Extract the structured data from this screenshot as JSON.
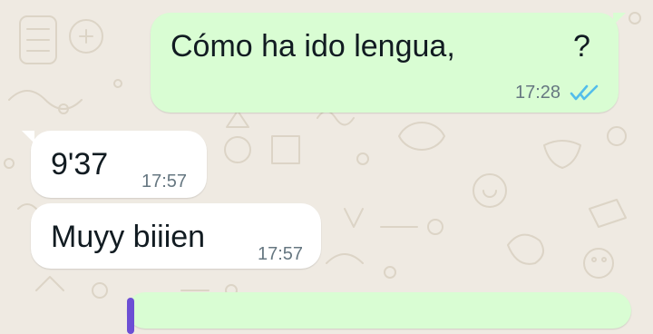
{
  "messages": [
    {
      "direction": "outgoing",
      "text": "Cómo ha ido lengua,",
      "text_end": "?",
      "time": "17:28",
      "status": "read",
      "status_icon": "double-check-icon"
    },
    {
      "direction": "incoming",
      "text": "9'37",
      "time": "17:57"
    },
    {
      "direction": "incoming",
      "text": "Muyy biiien",
      "time": "17:57"
    }
  ],
  "colors": {
    "background": "#efeae2",
    "outgoing_bubble": "#d9fdd3",
    "incoming_bubble": "#ffffff",
    "read_ticks": "#53bdeb",
    "timestamp": "#667781",
    "text": "#111b21"
  }
}
